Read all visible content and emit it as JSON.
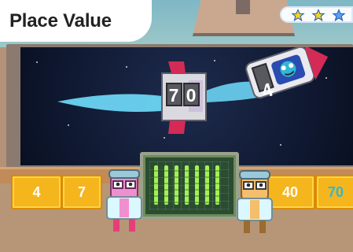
{
  "title": "Place Value",
  "stars": {
    "filled": 2,
    "total": 3
  },
  "rocket": {
    "front_digit": "4",
    "back_digits": [
      "7",
      "0"
    ]
  },
  "tiles": [
    {
      "label": "4",
      "highlight": false
    },
    {
      "label": "7",
      "highlight": false
    },
    {
      "label": "40",
      "highlight": false
    },
    {
      "label": "70",
      "highlight": true
    }
  ],
  "abacus": {
    "rods": 7
  },
  "colors": {
    "tile": "#f4b51d",
    "tile_border": "#d98b00",
    "highlight_text": "#31b7d3",
    "board": "#0f1830",
    "abacus_bead": "#a6ef5a",
    "rocket_red": "#d42b56",
    "flame": "#6bd4f3"
  }
}
